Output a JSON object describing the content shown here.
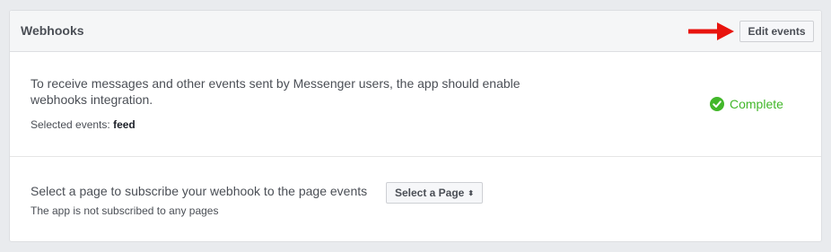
{
  "header": {
    "title": "Webhooks",
    "edit_button_label": "Edit events"
  },
  "webhooks_section": {
    "description": "To receive messages and other events sent by Messenger users, the app should enable webhooks integration.",
    "selected_events_label": "Selected events:",
    "selected_events_value": "feed",
    "status_text": "Complete",
    "status_icon": "check-circle-icon",
    "status_color": "#42b72a"
  },
  "subscription_section": {
    "prompt": "Select a page to subscribe your webhook to the page events",
    "select_button_label": "Select a Page",
    "select_caret": "⬍",
    "subscription_status": "The app is not subscribed to any pages"
  },
  "annotation": {
    "arrow_color": "#e8140e",
    "arrow_icon": "arrow-right-icon"
  }
}
